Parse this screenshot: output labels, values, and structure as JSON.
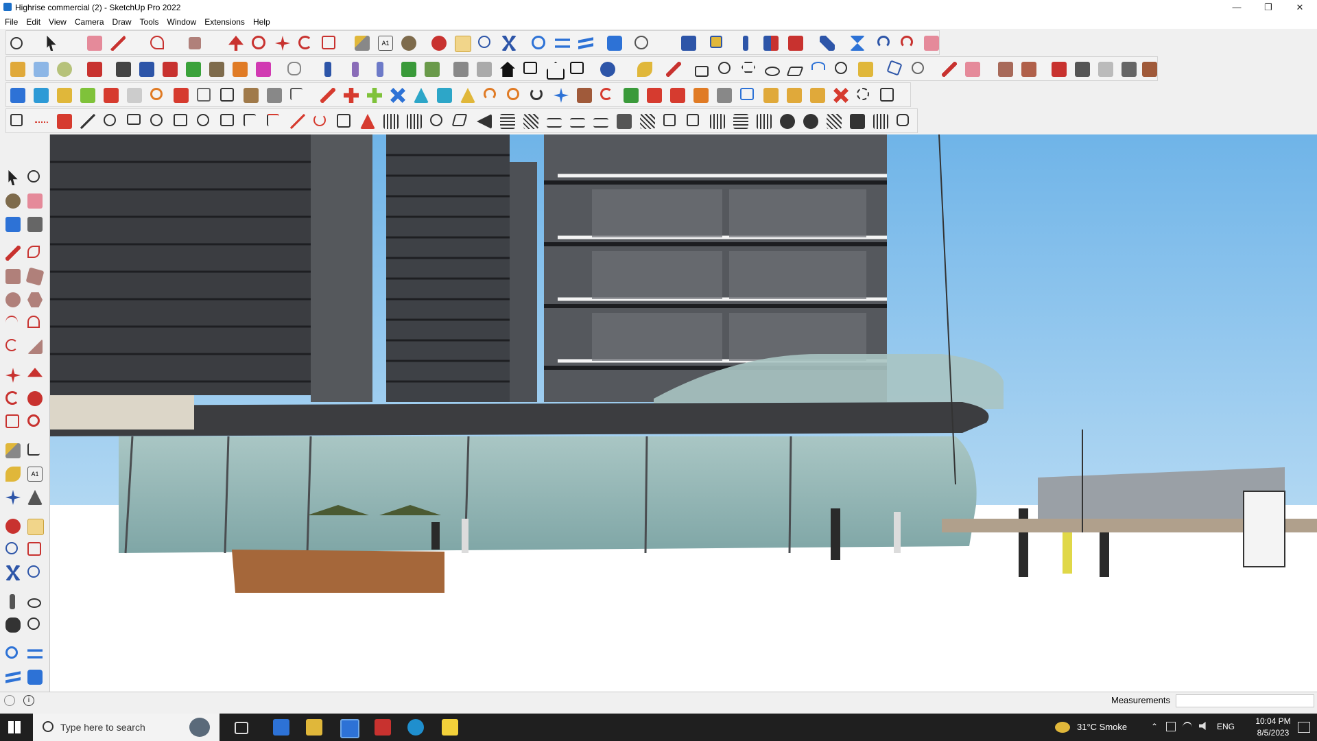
{
  "window": {
    "title": "Highrise commercial (2) - SketchUp Pro 2022",
    "controls": [
      "minimize-icon",
      "restore-icon",
      "close-icon"
    ]
  },
  "menu": [
    "File",
    "Edit",
    "View",
    "Camera",
    "Draw",
    "Tools",
    "Window",
    "Extensions",
    "Help"
  ],
  "status": {
    "measurements_label": "Measurements",
    "measurements_value": ""
  },
  "taskbar": {
    "search_placeholder": "Type here to search",
    "weather": "31°C  Smoke",
    "language": "ENG",
    "time": "10:04 PM",
    "date": "8/5/2023"
  },
  "colors": {
    "sky_top": "#6fb4e8",
    "sky_bottom": "#d2e9f8",
    "taskbar": "#1f1f1f",
    "accent_red": "#d63b2f",
    "accent_blue": "#2d72d6"
  }
}
